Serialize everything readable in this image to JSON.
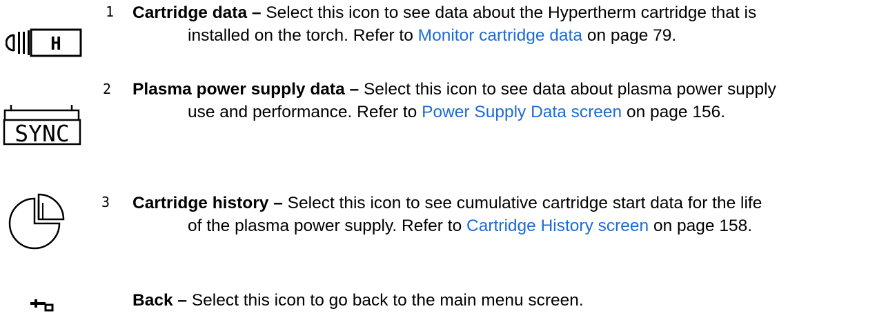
{
  "entries": [
    {
      "number": "1",
      "icon": "cartridge-icon",
      "icon_text": "H",
      "term": "Cartridge data –",
      "desc_line1": "Select this icon to see data about the Hypertherm cartridge that is",
      "desc_line2_pre": "installed on the torch. Refer to",
      "link": "Monitor cartridge data",
      "desc_line2_post": "on page 79."
    },
    {
      "number": "2",
      "icon": "power-supply-sync-icon",
      "icon_text": "SYNC",
      "term": "Plasma power supply data –",
      "desc_line1": "Select this icon to see data about plasma power supply",
      "desc_line2_pre": "use and performance. Refer to",
      "link": "Power Supply Data screen",
      "desc_line2_post": "on page 156."
    },
    {
      "number": "3",
      "icon": "pie-chart-icon",
      "term": "Cartridge history –",
      "desc_line1": "Select this icon to see cumulative cartridge start data for the life",
      "desc_line2_pre": "of the plasma power supply. Refer to",
      "link": "Cartridge History screen",
      "desc_line2_post": "on page 158."
    },
    {
      "icon": "back-arrow-icon",
      "term": "Back –",
      "desc_line1": "Select this icon to go back to the main menu screen."
    }
  ],
  "colors": {
    "link": "#1c6bd6",
    "text": "#000000"
  }
}
